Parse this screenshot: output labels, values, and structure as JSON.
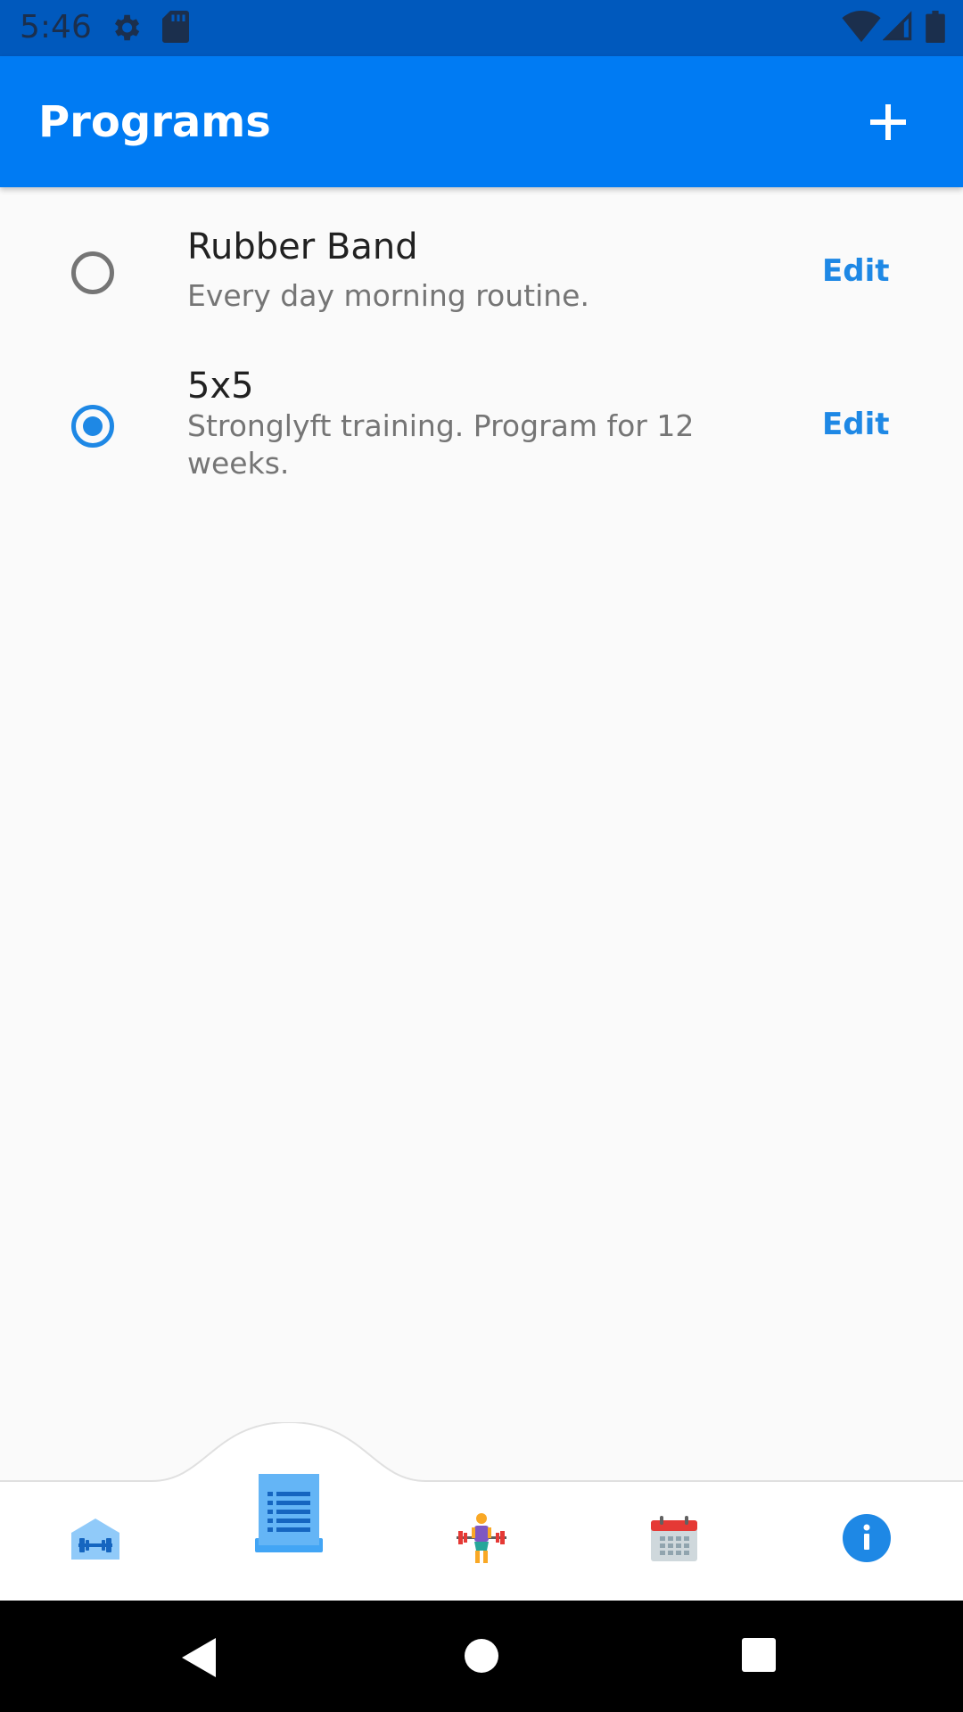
{
  "status_bar": {
    "time": "5:46",
    "icons": [
      "gear-icon",
      "sd-card-icon",
      "wifi-icon",
      "signal-icon",
      "battery-icon"
    ],
    "color": "#0059bd"
  },
  "app_bar": {
    "title": "Programs",
    "add_icon": "plus-icon",
    "color": "#007bf3"
  },
  "programs": [
    {
      "name": "Rubber Band",
      "description": "Every day morning routine.",
      "selected": false,
      "edit_label": "Edit"
    },
    {
      "name": "5x5",
      "description": "Stronglyft training. Program for 12 weeks.",
      "selected": true,
      "edit_label": "Edit"
    }
  ],
  "bottom_nav": {
    "items": [
      {
        "icon": "gym-icon",
        "active": false
      },
      {
        "icon": "programs-list-icon",
        "active": true
      },
      {
        "icon": "weightlifter-icon",
        "active": false
      },
      {
        "icon": "calendar-icon",
        "active": false
      },
      {
        "icon": "info-icon",
        "active": false
      }
    ]
  },
  "accent_color": "#1e88e5",
  "system_nav": {
    "icons": [
      "back-icon",
      "home-icon",
      "recents-icon"
    ]
  }
}
